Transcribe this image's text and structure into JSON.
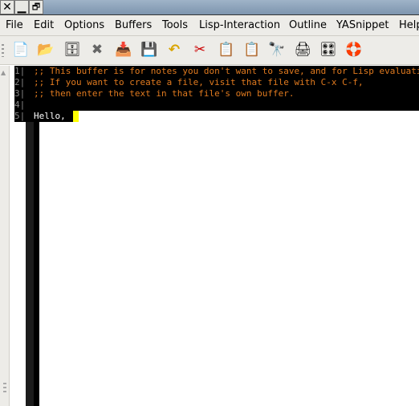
{
  "window": {
    "buttons": [
      {
        "name": "close",
        "glyph": "✕"
      },
      {
        "name": "minimize",
        "glyph": "▁"
      },
      {
        "name": "restore",
        "glyph": "🗗"
      }
    ]
  },
  "menubar": {
    "items": [
      "File",
      "Edit",
      "Options",
      "Buffers",
      "Tools",
      "Lisp-Interaction",
      "Outline",
      "YASnippet",
      "Help"
    ]
  },
  "toolbar": {
    "items": [
      {
        "name": "new-file",
        "glyph": "📄"
      },
      {
        "name": "open-folder",
        "glyph": "📂"
      },
      {
        "name": "dired",
        "glyph": "🗄"
      },
      {
        "name": "close-buffer",
        "glyph": "✖"
      },
      {
        "name": "save",
        "glyph": "📥"
      },
      {
        "name": "save-as",
        "glyph": "💾"
      },
      {
        "name": "undo",
        "glyph": "↶"
      },
      {
        "name": "cut",
        "glyph": "✂"
      },
      {
        "name": "copy",
        "glyph": "📋"
      },
      {
        "name": "paste",
        "glyph": "📋"
      },
      {
        "name": "search",
        "glyph": "🔭"
      },
      {
        "name": "print",
        "glyph": "🖨"
      },
      {
        "name": "customize",
        "glyph": "🎛"
      },
      {
        "name": "help",
        "glyph": "🛟"
      }
    ]
  },
  "editor": {
    "line_numbers": [
      "1|",
      "2|",
      "3|",
      "4|",
      "5|"
    ],
    "lines": [
      ";; This buffer is for notes you don't want to save, and for Lisp evaluation.",
      ";; If you want to create a file, visit that file with C-x C-f,",
      ";; then enter the text in that file's own buffer.",
      "",
      "Hello, "
    ],
    "comment_color": "#e07a1f",
    "cursor_color": "#ffff00"
  }
}
